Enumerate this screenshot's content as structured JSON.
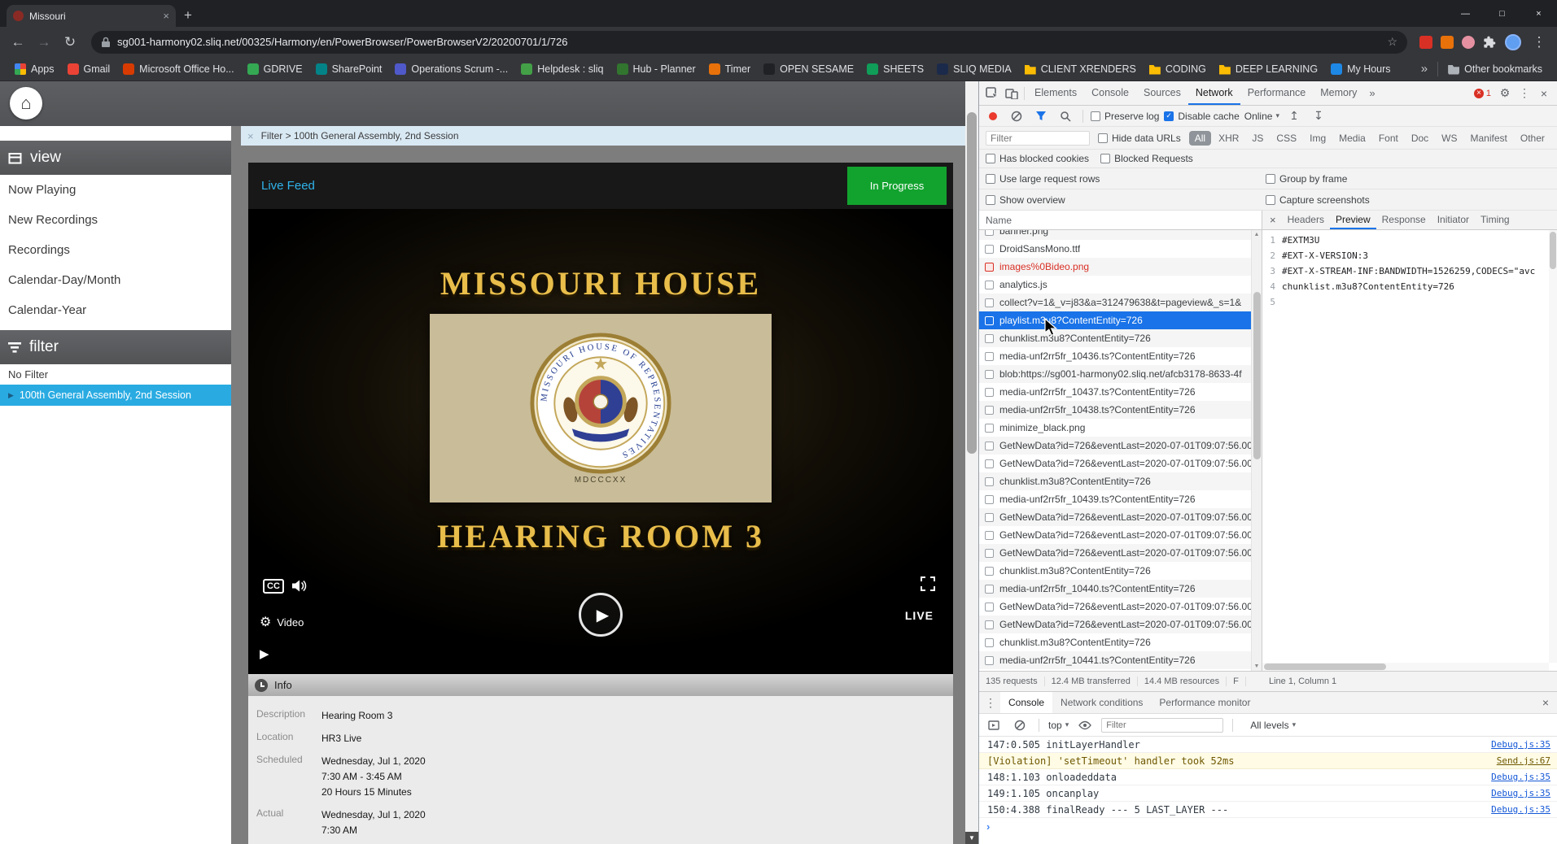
{
  "glyphs": {
    "back": "←",
    "forward": "→",
    "reload": "↻",
    "star": "☆",
    "menu_kebab": "⋮",
    "close": "×",
    "minimize": "—",
    "maximize": "□",
    "new_tab": "+",
    "home": "⌂",
    "gear": "⚙",
    "dropdown": "▾",
    "play": "▶",
    "up": "▲",
    "down": "▼",
    "prompt": "›",
    "upload": "↥",
    "download": "↧",
    "check": "✓"
  },
  "browser": {
    "tab_title": "Missouri",
    "url": "sg001-harmony02.sliq.net/00325/Harmony/en/PowerBrowser/PowerBrowserV2/20200701/1/726",
    "bookmarks": [
      {
        "label": "Apps",
        "color": "multi",
        "type": "apps"
      },
      {
        "label": "Gmail",
        "color": "#ea4335",
        "type": "site"
      },
      {
        "label": "Microsoft Office Ho...",
        "color": "#d83b01",
        "type": "site"
      },
      {
        "label": "GDRIVE",
        "color": "#34a853",
        "type": "site"
      },
      {
        "label": "SharePoint",
        "color": "#038387",
        "type": "site"
      },
      {
        "label": "Operations Scrum -...",
        "color": "#5059c9",
        "type": "site"
      },
      {
        "label": "Helpdesk : sliq",
        "color": "#43a047",
        "type": "site"
      },
      {
        "label": "Hub - Planner",
        "color": "#31752f",
        "type": "site"
      },
      {
        "label": "Timer",
        "color": "#e8710a",
        "type": "site"
      },
      {
        "label": "OPEN SESAME",
        "color": "#202124",
        "type": "site"
      },
      {
        "label": "SHEETS",
        "color": "#0f9d58",
        "type": "site"
      },
      {
        "label": "SLIQ MEDIA",
        "color": "#1b2a4a",
        "type": "site"
      },
      {
        "label": "CLIENT XRENDERS",
        "color": "#fbbc04",
        "type": "folder"
      },
      {
        "label": "CODING",
        "color": "#fbbc04",
        "type": "folder"
      },
      {
        "label": "DEEP LEARNING",
        "color": "#fbbc04",
        "type": "folder"
      },
      {
        "label": "My Hours",
        "color": "#1e88e5",
        "type": "site"
      }
    ],
    "bookmarks_overflow": "»",
    "other_bookmarks_label": "Other bookmarks"
  },
  "app": {
    "sidebar": {
      "view_header": "view",
      "view_items": [
        "Now Playing",
        "New Recordings",
        "Recordings",
        "Calendar-Day/Month",
        "Calendar-Year"
      ],
      "filter_header": "filter",
      "no_filter_item": "No Filter",
      "active_filter_item": "100th General Assembly, 2nd Session"
    },
    "breadcrumb": "Filter > 100th General Assembly, 2nd Session",
    "player": {
      "feed_label": "Live Feed",
      "status_badge": "In Progress",
      "video_title": "MISSOURI HOUSE",
      "video_subtitle": "HEARING ROOM 3",
      "seal_text": "MISSOURI HOUSE OF REPRESENTATIVES",
      "seal_motto": "MDCCCXX",
      "cc_label": "CC",
      "live_label": "LIVE",
      "settings_label": "Video"
    },
    "info": {
      "header": "Info",
      "fields": [
        {
          "label": "Description",
          "value": "Hearing Room 3"
        },
        {
          "label": "Location",
          "value": "HR3 Live"
        },
        {
          "label": "Scheduled",
          "value": "Wednesday, Jul 1, 2020\n7:30 AM - 3:45 AM\n20 Hours 15 Minutes"
        },
        {
          "label": "Actual",
          "value": "Wednesday, Jul 1, 2020\n7:30 AM"
        }
      ]
    }
  },
  "devtools": {
    "main_tabs": [
      {
        "label": "Elements",
        "state": ""
      },
      {
        "label": "Console",
        "state": ""
      },
      {
        "label": "Sources",
        "state": ""
      },
      {
        "label": "Network",
        "state": "active"
      },
      {
        "label": "Performance",
        "state": ""
      },
      {
        "label": "Memory",
        "state": ""
      }
    ],
    "tabs_overflow": "»",
    "error_count": "1",
    "network": {
      "preserve_log_label": "Preserve log",
      "disable_cache_label": "Disable cache",
      "throttling_value": "Online",
      "filter_placeholder": "Filter",
      "hide_data_urls_label": "Hide data URLs",
      "type_filters": [
        {
          "label": "All",
          "state": "active"
        },
        {
          "label": "XHR",
          "state": ""
        },
        {
          "label": "JS",
          "state": ""
        },
        {
          "label": "CSS",
          "state": ""
        },
        {
          "label": "Img",
          "state": ""
        },
        {
          "label": "Media",
          "state": ""
        },
        {
          "label": "Font",
          "state": ""
        },
        {
          "label": "Doc",
          "state": ""
        },
        {
          "label": "WS",
          "state": ""
        },
        {
          "label": "Manifest",
          "state": ""
        },
        {
          "label": "Other",
          "state": ""
        }
      ],
      "has_blocked_cookies_label": "Has blocked cookies",
      "blocked_requests_label": "Blocked Requests",
      "use_large_rows_label": "Use large request rows",
      "group_by_frame_label": "Group by frame",
      "show_overview_label": "Show overview",
      "capture_screenshots_label": "Capture screenshots",
      "name_column": "Name",
      "requests": [
        {
          "name": "banner.png",
          "state": ""
        },
        {
          "name": "DroidSansMono.ttf",
          "state": ""
        },
        {
          "name": "images%0Bideo.png",
          "state": "error"
        },
        {
          "name": "analytics.js",
          "state": ""
        },
        {
          "name": "collect?v=1&_v=j83&a=312479638&t=pageview&_s=1&",
          "state": ""
        },
        {
          "name": "playlist.m3u8?ContentEntity=726",
          "state": "selected"
        },
        {
          "name": "chunklist.m3u8?ContentEntity=726",
          "state": ""
        },
        {
          "name": "media-unf2rr5fr_10436.ts?ContentEntity=726",
          "state": ""
        },
        {
          "name": "blob:https://sg001-harmony02.sliq.net/afcb3178-8633-4f",
          "state": ""
        },
        {
          "name": "media-unf2rr5fr_10437.ts?ContentEntity=726",
          "state": ""
        },
        {
          "name": "media-unf2rr5fr_10438.ts?ContentEntity=726",
          "state": ""
        },
        {
          "name": "minimize_black.png",
          "state": ""
        },
        {
          "name": "GetNewData?id=726&eventLast=2020-07-01T09:07:56.00",
          "state": ""
        },
        {
          "name": "GetNewData?id=726&eventLast=2020-07-01T09:07:56.00",
          "state": ""
        },
        {
          "name": "chunklist.m3u8?ContentEntity=726",
          "state": ""
        },
        {
          "name": "media-unf2rr5fr_10439.ts?ContentEntity=726",
          "state": ""
        },
        {
          "name": "GetNewData?id=726&eventLast=2020-07-01T09:07:56.00",
          "state": ""
        },
        {
          "name": "GetNewData?id=726&eventLast=2020-07-01T09:07:56.00",
          "state": ""
        },
        {
          "name": "GetNewData?id=726&eventLast=2020-07-01T09:07:56.00",
          "state": ""
        },
        {
          "name": "chunklist.m3u8?ContentEntity=726",
          "state": ""
        },
        {
          "name": "media-unf2rr5fr_10440.ts?ContentEntity=726",
          "state": ""
        },
        {
          "name": "GetNewData?id=726&eventLast=2020-07-01T09:07:56.00",
          "state": ""
        },
        {
          "name": "GetNewData?id=726&eventLast=2020-07-01T09:07:56.00",
          "state": ""
        },
        {
          "name": "chunklist.m3u8?ContentEntity=726",
          "state": ""
        },
        {
          "name": "media-unf2rr5fr_10441.ts?ContentEntity=726",
          "state": ""
        }
      ],
      "summary": [
        "135 requests",
        "12.4 MB transferred",
        "14.4 MB resources",
        "F"
      ],
      "detail_tabs": [
        {
          "label": "Headers",
          "state": ""
        },
        {
          "label": "Preview",
          "state": "active"
        },
        {
          "label": "Response",
          "state": ""
        },
        {
          "label": "Initiator",
          "state": ""
        },
        {
          "label": "Timing",
          "state": ""
        }
      ],
      "preview_lines": [
        "#EXTM3U",
        "#EXT-X-VERSION:3",
        "#EXT-X-STREAM-INF:BANDWIDTH=1526259,CODECS=\"avc",
        "chunklist.m3u8?ContentEntity=726",
        ""
      ],
      "cursor_position": "Line 1, Column 1"
    },
    "drawer": {
      "tabs": [
        {
          "label": "Console",
          "state": "active"
        },
        {
          "label": "Network conditions",
          "state": ""
        },
        {
          "label": "Performance monitor",
          "state": ""
        }
      ],
      "context_value": "top",
      "filter_placeholder": "Filter",
      "levels_value": "All levels",
      "messages": [
        {
          "text": "147:0.505 initLayerHandler",
          "source": "Debug.js:35",
          "type": "log"
        },
        {
          "text": "[Violation] 'setTimeout' handler took 52ms",
          "source": "Send.js:67",
          "type": "violation"
        },
        {
          "text": "148:1.103 onloadeddata",
          "source": "Debug.js:35",
          "type": "log"
        },
        {
          "text": "149:1.105 oncanplay",
          "source": "Debug.js:35",
          "type": "log"
        },
        {
          "text": "150:4.388 finalReady --- 5 LAST_LAYER ---",
          "source": "Debug.js:35",
          "type": "log"
        }
      ]
    }
  }
}
